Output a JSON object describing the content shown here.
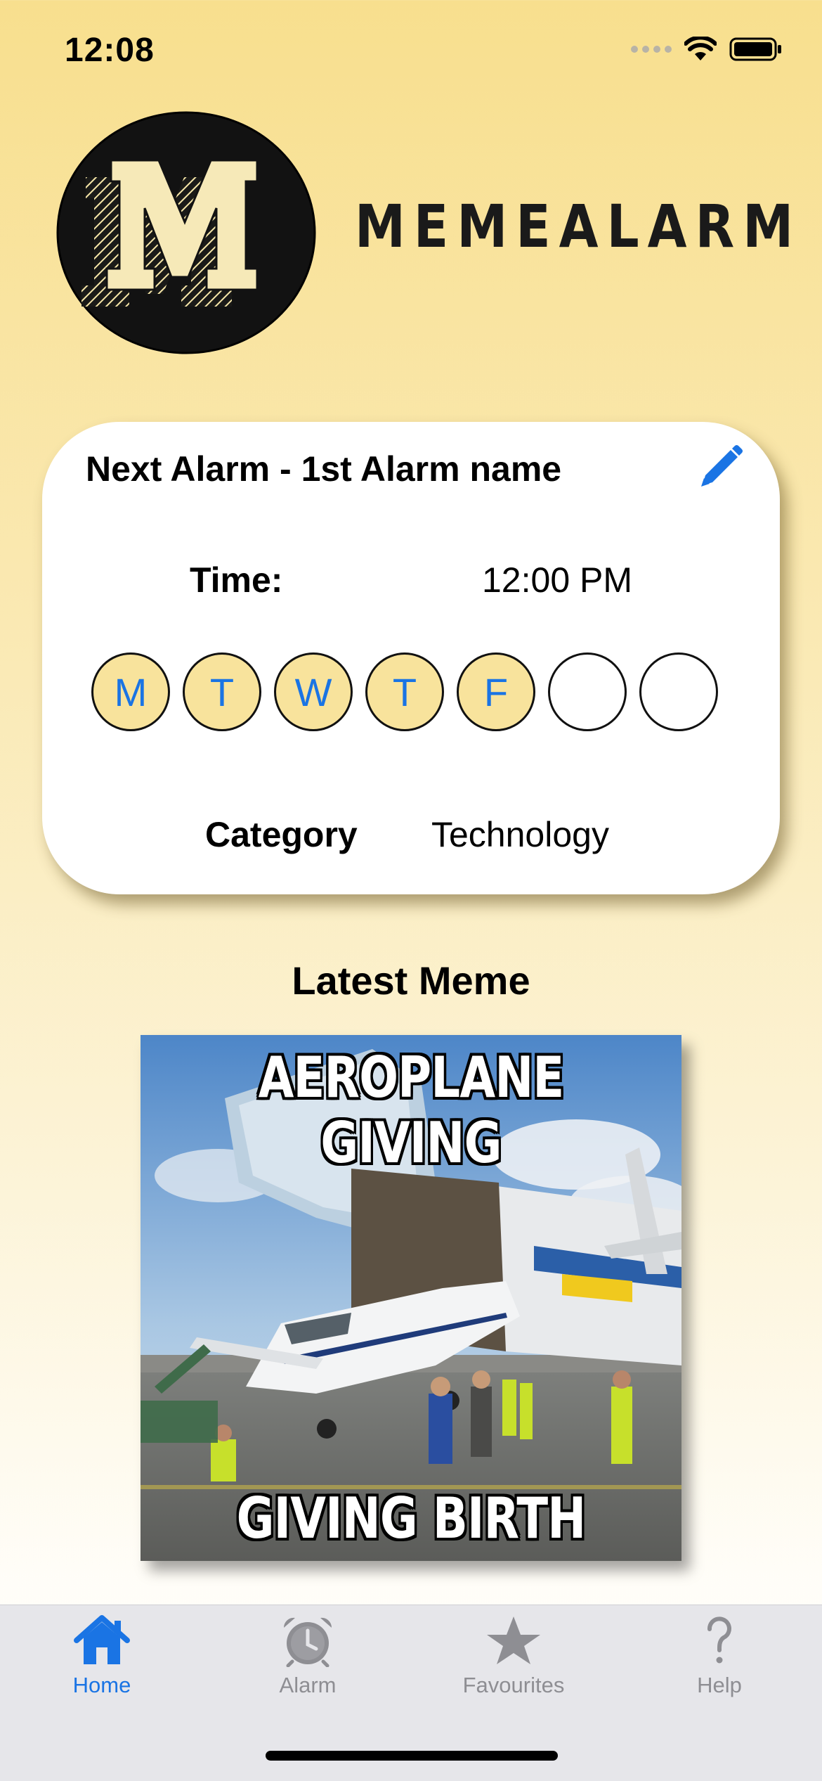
{
  "status_bar": {
    "time": "12:08"
  },
  "brand": {
    "logo_letter": "M",
    "name": "MEMEALARM"
  },
  "next_alarm": {
    "title": "Next Alarm - 1st Alarm name",
    "time_label": "Time:",
    "time_value": "12:00 PM",
    "days": [
      {
        "label": "M",
        "active": true
      },
      {
        "label": "T",
        "active": true
      },
      {
        "label": "W",
        "active": true
      },
      {
        "label": "T",
        "active": true
      },
      {
        "label": "F",
        "active": true
      },
      {
        "label": "",
        "active": false
      },
      {
        "label": "",
        "active": false
      }
    ],
    "category_label": "Category",
    "category_value": "Technology"
  },
  "latest_meme": {
    "heading": "Latest Meme",
    "caption_top": "AEROPLANE GIVING",
    "caption_bottom": "GIVING BIRTH"
  },
  "tab_bar": {
    "items": [
      {
        "label": "Home",
        "icon": "house-icon",
        "active": true
      },
      {
        "label": "Alarm",
        "icon": "alarm-clock-icon",
        "active": false
      },
      {
        "label": "Favourites",
        "icon": "star-icon",
        "active": false
      },
      {
        "label": "Help",
        "icon": "question-mark-icon",
        "active": false
      }
    ]
  },
  "colors": {
    "accent": "#1a74e4",
    "active_day_fill": "#f8e39c",
    "background_top": "#f8df8e",
    "tab_bar": "#e6e6ea",
    "tab_inactive": "#8e8e93"
  }
}
